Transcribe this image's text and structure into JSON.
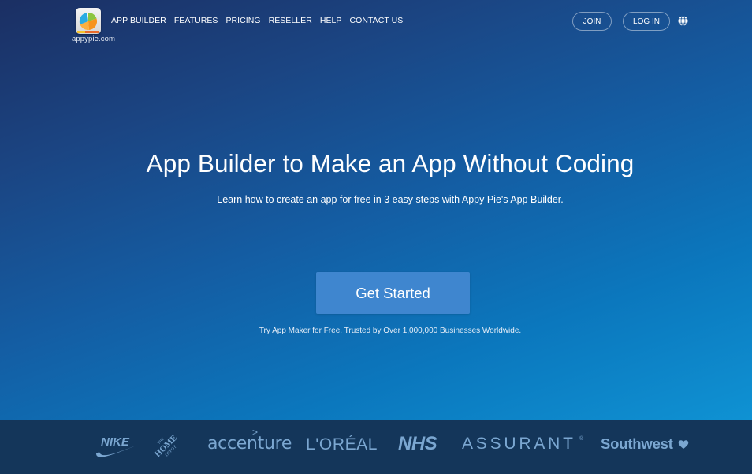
{
  "header": {
    "logo_text": "appypie.com",
    "nav": [
      {
        "label": "APP BUILDER"
      },
      {
        "label": "FEATURES"
      },
      {
        "label": "PRICING"
      },
      {
        "label": "RESELLER"
      },
      {
        "label": "HELP"
      },
      {
        "label": "CONTACT US"
      }
    ],
    "join_label": "JOIN",
    "login_label": "LOG IN",
    "language_icon": "globe-icon"
  },
  "hero": {
    "title": "App Builder to Make an App Without Coding",
    "subtitle": "Learn how to create an app for free in 3 easy steps with Appy Pie's App Builder.",
    "cta_label": "Get Started",
    "trust_text": "Try App Maker for Free. Trusted by Over 1,000,000 Businesses Worldwide."
  },
  "clients": {
    "logos": [
      {
        "name": "NIKE"
      },
      {
        "name": "THE HOME DEPOT"
      },
      {
        "name": "accenture"
      },
      {
        "name": "L'ORÉAL"
      },
      {
        "name": "NHS"
      },
      {
        "name": "ASSURANT"
      },
      {
        "name": "Southwest"
      }
    ],
    "accenture_caret": ">",
    "assurant_mark": "®"
  },
  "colors": {
    "hero_gradient_start": "#1b2f63",
    "hero_gradient_end": "#0f92d3",
    "cta_background": "#3f86cf",
    "logo_strip_background": "#14365a",
    "logo_color": "#7ba7d1"
  }
}
